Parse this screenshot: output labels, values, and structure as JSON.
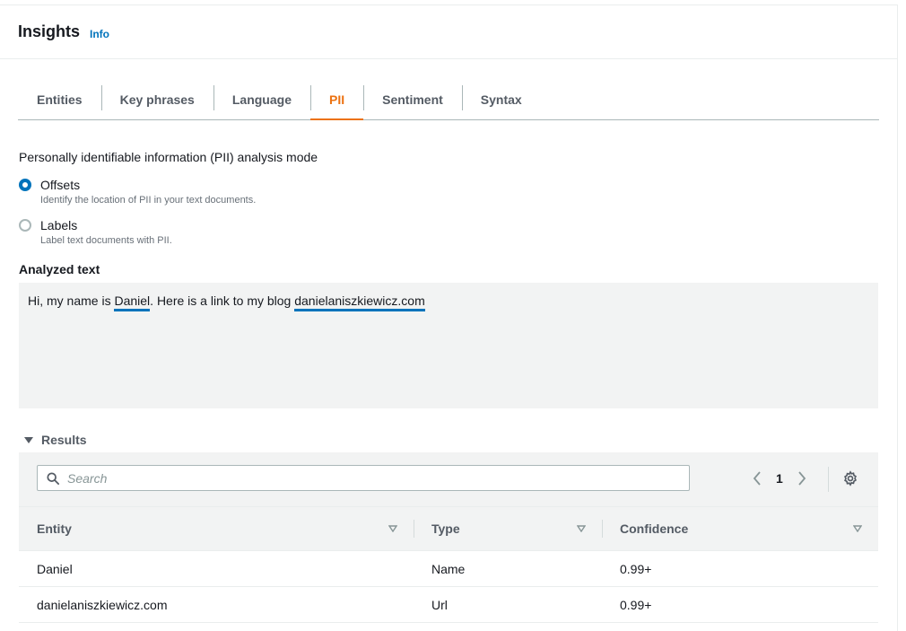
{
  "header": {
    "title": "Insights",
    "info_link": "Info"
  },
  "tabs": [
    {
      "label": "Entities",
      "active": false
    },
    {
      "label": "Key phrases",
      "active": false
    },
    {
      "label": "Language",
      "active": false
    },
    {
      "label": "PII",
      "active": true
    },
    {
      "label": "Sentiment",
      "active": false
    },
    {
      "label": "Syntax",
      "active": false
    }
  ],
  "pii_mode": {
    "label": "Personally identifiable information (PII) analysis mode",
    "options": [
      {
        "label": "Offsets",
        "description": "Identify the location of PII in your text documents.",
        "checked": true
      },
      {
        "label": "Labels",
        "description": "Label text documents with PII.",
        "checked": false
      }
    ]
  },
  "analyzed_text": {
    "label": "Analyzed text",
    "prefix": "Hi, my name is ",
    "pii_1": "Daniel",
    "middle": ". Here is a link to my blog ",
    "pii_2": "danielaniszkiewicz.com"
  },
  "results": {
    "label": "Results",
    "search_placeholder": "Search",
    "page_number": "1",
    "columns": [
      "Entity",
      "Type",
      "Confidence"
    ],
    "rows": [
      {
        "entity": "Daniel",
        "type": "Name",
        "confidence": "0.99+"
      },
      {
        "entity": "danielaniszkiewicz.com",
        "type": "Url",
        "confidence": "0.99+"
      }
    ]
  },
  "colors": {
    "accent": "#0073bb",
    "active_tab": "#ec7211",
    "muted_text": "#545b64",
    "panel_bg": "#f2f3f3"
  }
}
